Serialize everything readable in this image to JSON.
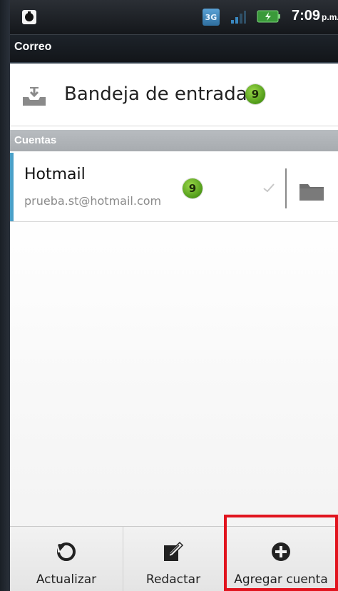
{
  "status_bar": {
    "left_icon": "notification-icon",
    "network_label": "3G",
    "signal_icon": "signal-icon",
    "battery_icon": "battery-charging-icon",
    "time": "7:09",
    "ampm": "p.m."
  },
  "title_bar": {
    "title": "Correo"
  },
  "inbox": {
    "icon": "inbox-icon",
    "label": "Bandeja de entrada...",
    "unread_count": "9"
  },
  "accounts_section": {
    "title": "Cuentas",
    "items": [
      {
        "name": "Hotmail",
        "email": "prueba.st@hotmail.com",
        "unread_count": "9",
        "accent_color": "#4aa0c8"
      }
    ]
  },
  "action_bar": {
    "items": [
      {
        "label": "Actualizar",
        "icon": "refresh-icon"
      },
      {
        "label": "Redactar",
        "icon": "compose-icon"
      },
      {
        "label": "Agregar cuenta",
        "icon": "add-circle-icon"
      }
    ]
  },
  "highlight": {
    "target": "Agregar cuenta",
    "color": "#e1141e"
  },
  "colors": {
    "badge_green": "#6bbd2a",
    "section_header": "#b0b4b8",
    "title_bar": "#161a1f"
  }
}
